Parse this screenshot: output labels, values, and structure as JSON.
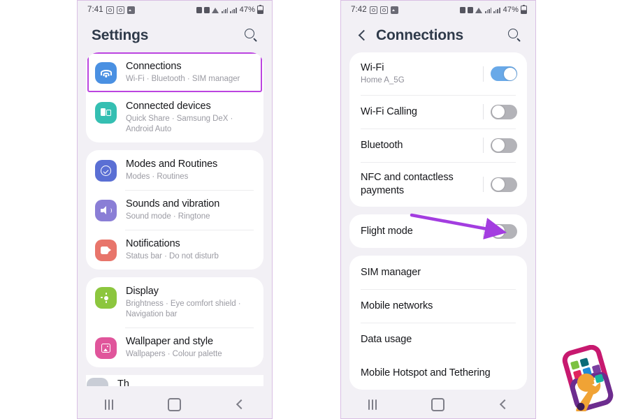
{
  "page": {
    "background": "#ffffff",
    "accent_purple": "#bb44e0"
  },
  "phone_left": {
    "status_bar": {
      "time": "7:41",
      "battery_percent": "47%",
      "left_icons": [
        "camera-icon",
        "camera-icon",
        "gallery-icon"
      ],
      "right_icons": [
        "app-icon",
        "alarm-icon",
        "wifi-icon",
        "network-icon",
        "signal-icon",
        "battery-icon"
      ]
    },
    "header": {
      "title": "Settings",
      "search_icon": "search-icon"
    },
    "groups": [
      {
        "id": "group-connections",
        "items": [
          {
            "title": "Connections",
            "subtitle": "Wi-Fi  ·  Bluetooth  ·  SIM manager",
            "icon": "wifi-icon",
            "icon_color": "#4a90e2",
            "highlighted": true
          },
          {
            "title": "Connected devices",
            "subtitle": "Quick Share  ·  Samsung DeX  ·  Android Auto",
            "icon": "devices-icon",
            "icon_color": "#35bfb2",
            "highlighted": false
          }
        ]
      },
      {
        "id": "group-personalisation",
        "items": [
          {
            "title": "Modes and Routines",
            "subtitle": "Modes  ·  Routines",
            "icon": "check-circle-icon",
            "icon_color": "#5a6fd4",
            "highlighted": false
          },
          {
            "title": "Sounds and vibration",
            "subtitle": "Sound mode  ·  Ringtone",
            "icon": "speaker-icon",
            "icon_color": "#8a7ed6",
            "highlighted": false
          },
          {
            "title": "Notifications",
            "subtitle": "Status bar  ·  Do not disturb",
            "icon": "notification-icon",
            "icon_color": "#e8756b",
            "highlighted": false
          }
        ]
      },
      {
        "id": "group-display",
        "items": [
          {
            "title": "Display",
            "subtitle": "Brightness  ·  Eye comfort shield  ·  Navigation bar",
            "icon": "brightness-icon",
            "icon_color": "#8cc63e",
            "highlighted": false
          },
          {
            "title": "Wallpaper and style",
            "subtitle": "Wallpapers  ·  Colour palette",
            "icon": "wallpaper-icon",
            "icon_color": "#e0559b",
            "highlighted": false
          }
        ]
      }
    ],
    "peek_row_title": "Th",
    "nav_bar": {
      "recents": "recents-icon",
      "home": "home-icon",
      "back": "back-icon"
    }
  },
  "phone_right": {
    "status_bar": {
      "time": "7:42",
      "battery_percent": "47%"
    },
    "header": {
      "title": "Connections",
      "back_icon": "back-chevron-icon",
      "search_icon": "search-icon"
    },
    "groups": [
      {
        "id": "group-wireless",
        "items": [
          {
            "title": "Wi-Fi",
            "subtitle": "Home A_5G",
            "toggle": true,
            "has_toggle": true
          },
          {
            "title": "Wi-Fi Calling",
            "subtitle": "",
            "toggle": false,
            "has_toggle": true
          },
          {
            "title": "Bluetooth",
            "subtitle": "",
            "toggle": false,
            "has_toggle": true
          },
          {
            "title": "NFC and contactless payments",
            "subtitle": "",
            "toggle": false,
            "has_toggle": true
          }
        ]
      },
      {
        "id": "group-flight",
        "items": [
          {
            "title": "Flight mode",
            "subtitle": "",
            "toggle": false,
            "has_toggle": true
          }
        ]
      },
      {
        "id": "group-network",
        "items": [
          {
            "title": "SIM manager",
            "subtitle": "",
            "has_toggle": false
          },
          {
            "title": "Mobile networks",
            "subtitle": "",
            "has_toggle": false
          },
          {
            "title": "Data usage",
            "subtitle": "",
            "has_toggle": false
          },
          {
            "title": "Mobile Hotspot and Tethering",
            "subtitle": "",
            "has_toggle": false
          }
        ]
      }
    ],
    "annotation": {
      "type": "arrow",
      "points_to": "Flight mode toggle",
      "color": "#a33de0"
    },
    "nav_bar": {
      "recents": "recents-icon",
      "home": "home-icon",
      "back": "back-icon"
    }
  },
  "brand_logo": {
    "name": "smartphone-wrench-logo",
    "frame_color": "#c7196f",
    "wrench_color": "#f0a335",
    "tile_colors": [
      "#7cc242",
      "#0b6b78",
      "#e0245e",
      "#1f8ad6",
      "#7b3fa0",
      "#e8a33d",
      "#18b5a0"
    ]
  }
}
